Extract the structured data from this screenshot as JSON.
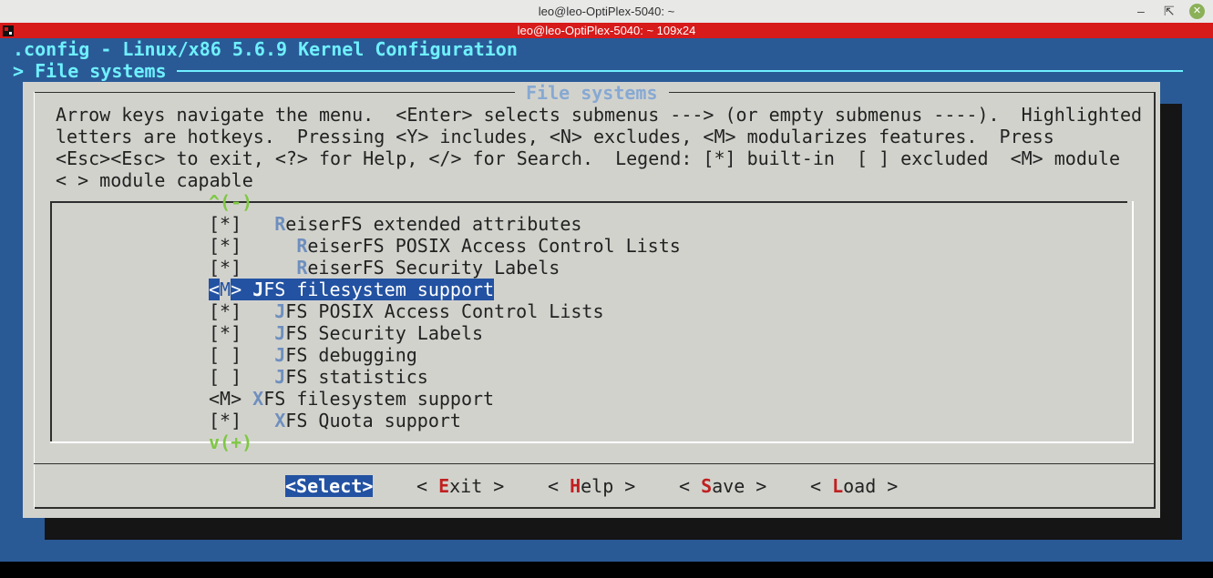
{
  "window": {
    "title": "leo@leo-OptiPlex-5040: ~",
    "tab_title": "leo@leo-OptiPlex-5040: ~ 109x24",
    "minimize_glyph": "‒",
    "maximize_glyph": "⇱",
    "close_glyph": "✕"
  },
  "terminal": {
    "config_title": ".config - Linux/x86 5.6.9 Kernel Configuration",
    "breadcrumb": "> File systems"
  },
  "dialog": {
    "title": "File systems",
    "help_lines": [
      "Arrow keys navigate the menu.  <Enter> selects submenus ---> (or empty submenus ----).  Highlighted",
      "letters are hotkeys.  Pressing <Y> includes, <N> excludes, <M> modularizes features.  Press",
      "<Esc><Esc> to exit, <?> for Help, </> for Search.  Legend: [*] built-in  [ ] excluded  <M> module",
      "< > module capable"
    ],
    "scroll_up": "^(-)",
    "scroll_down": "v(+)"
  },
  "menu_items": [
    {
      "state": "[*]",
      "indent": "   ",
      "hotkey": "R",
      "rest": "eiserFS extended attributes",
      "selected": false
    },
    {
      "state": "[*]",
      "indent": "     ",
      "hotkey": "R",
      "rest": "eiserFS POSIX Access Control Lists",
      "selected": false
    },
    {
      "state": "[*]",
      "indent": "     ",
      "hotkey": "R",
      "rest": "eiserFS Security Labels",
      "selected": false
    },
    {
      "state_open": "<",
      "state_val": "M",
      "state_close": ">",
      "indent": " ",
      "hotkey": "J",
      "rest": "FS filesystem support",
      "selected": true
    },
    {
      "state": "[*]",
      "indent": "   ",
      "hotkey": "J",
      "rest": "FS POSIX Access Control Lists",
      "selected": false
    },
    {
      "state": "[*]",
      "indent": "   ",
      "hotkey": "J",
      "rest": "FS Security Labels",
      "selected": false
    },
    {
      "state": "[ ]",
      "indent": "   ",
      "hotkey": "J",
      "rest": "FS debugging",
      "selected": false
    },
    {
      "state": "[ ]",
      "indent": "   ",
      "hotkey": "J",
      "rest": "FS statistics",
      "selected": false
    },
    {
      "state": "<M>",
      "indent": " ",
      "hotkey": "X",
      "rest": "FS filesystem support",
      "selected": false
    },
    {
      "state": "[*]",
      "indent": "   ",
      "hotkey": "X",
      "rest": "FS Quota support",
      "selected": false
    }
  ],
  "buttons": [
    {
      "pre": "<",
      "hotkey": "S",
      "rest": "elect",
      "post": ">",
      "selected": true
    },
    {
      "pre": "< ",
      "hotkey": "E",
      "rest": "xit",
      "post": " >",
      "selected": false
    },
    {
      "pre": "< ",
      "hotkey": "H",
      "rest": "elp",
      "post": " >",
      "selected": false
    },
    {
      "pre": "< ",
      "hotkey": "S",
      "rest": "ave",
      "post": " >",
      "selected": false
    },
    {
      "pre": "< ",
      "hotkey": "L",
      "rest": "oad",
      "post": " >",
      "selected": false
    }
  ],
  "colors": {
    "terminal_bg": "#2a5a96",
    "dialog_bg": "#d2d2cd",
    "selection": "#2352a2",
    "title_cyan": "#6ff0ff",
    "hotkey_blue": "#6e8fbe",
    "hotkey_red": "#c02020",
    "scroll_green": "#7ec843",
    "tab_red": "#d71a1a"
  }
}
